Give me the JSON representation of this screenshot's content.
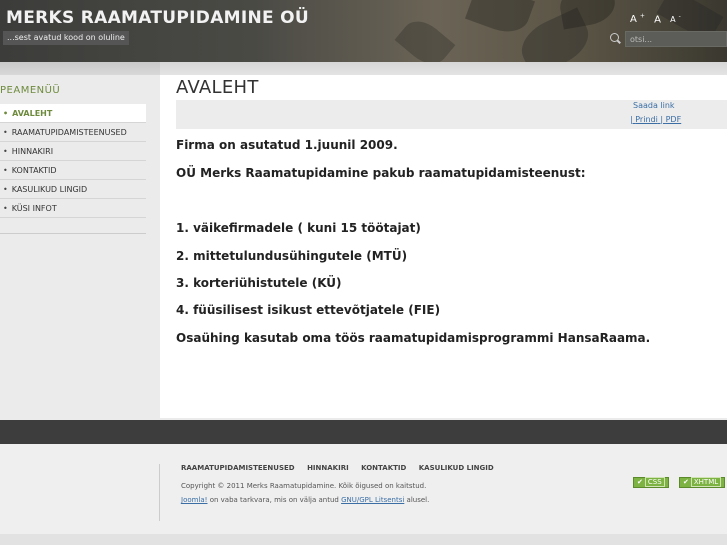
{
  "header": {
    "site_title": "MERKS RAAMATUPIDAMINE OÜ",
    "slogan": "...sest avatud kood on oluline",
    "font_tools": [
      "A+",
      "A",
      "A-"
    ],
    "search_placeholder": "otsi..."
  },
  "sidebar": {
    "title": "PEAMENÜÜ",
    "items": [
      {
        "label": "AVALEHT",
        "active": true
      },
      {
        "label": "RAAMATUPIDAMISTEENUSED",
        "active": false
      },
      {
        "label": "HINNAKIRI",
        "active": false
      },
      {
        "label": "KONTAKTID",
        "active": false
      },
      {
        "label": "KASULIKUD LINGID",
        "active": false
      },
      {
        "label": "KÜSI INFOT",
        "active": false
      }
    ]
  },
  "main": {
    "title": "AVALEHT",
    "email_link": "Saada link",
    "print_label": "Prindi",
    "pdf_label": "PDF",
    "paragraphs": [
      "Firma  on asutatud 1.juunil 2009.",
      "OÜ Merks Raamatupidamine pakub raamatupidamisteenust:",
      "1. väikefirmadele ( kuni 15 töötajat)",
      "2. mittetulundusühingutele (MTÜ)",
      "3. korteriühistutele (KÜ)",
      "4. füüsilisest isikust ettevõtjatele (FIE)",
      "Osaühing kasutab oma töös raamatupidamisprogrammi HansaRaama."
    ]
  },
  "footer": {
    "nav": [
      "RAAMATUPIDAMISTEENUSED",
      "HINNAKIRI",
      "KONTAKTID",
      "KASULIKUD LINGID"
    ],
    "copyright": "Copyright © 2011 Merks Raamatupidamine. Kõik õigused on kaitstud.",
    "joomla_link": "Joomla!",
    "joomla_mid": " on vaba tarkvara, mis on välja antud ",
    "license_link": "GNU/GPL Litsentsi",
    "joomla_end": " alusel.",
    "badges": [
      "CSS",
      "XHTML"
    ]
  },
  "colors": {
    "accent_green": "#6e8b3d",
    "link_blue": "#3a6ea5",
    "footer_bar": "#3d3d3d"
  }
}
